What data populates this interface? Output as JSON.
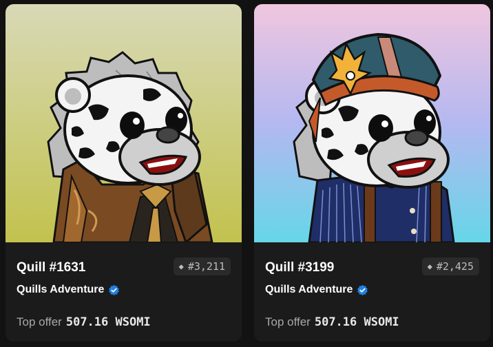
{
  "cards": [
    {
      "name": "Quill #1631",
      "rank": "#3,211",
      "rank_icon": "diamond-icon",
      "collection": "Quills Adventure",
      "verified_icon": "verified-badge-icon",
      "offer_label": "Top offer",
      "offer_amount": "507.16 WSOMI",
      "background": [
        "#d8d9b6",
        "#c2c24e"
      ]
    },
    {
      "name": "Quill #3199",
      "rank": "#2,425",
      "rank_icon": "diamond-icon",
      "collection": "Quills Adventure",
      "verified_icon": "verified-badge-icon",
      "offer_label": "Top offer",
      "offer_amount": "507.16 WSOMI",
      "background": [
        "#f0c6df",
        "#66d6e8"
      ]
    }
  ],
  "colors": {
    "page_background": "#121212",
    "card_background": "#1b1b1b",
    "verified_blue": "#2081e2"
  }
}
